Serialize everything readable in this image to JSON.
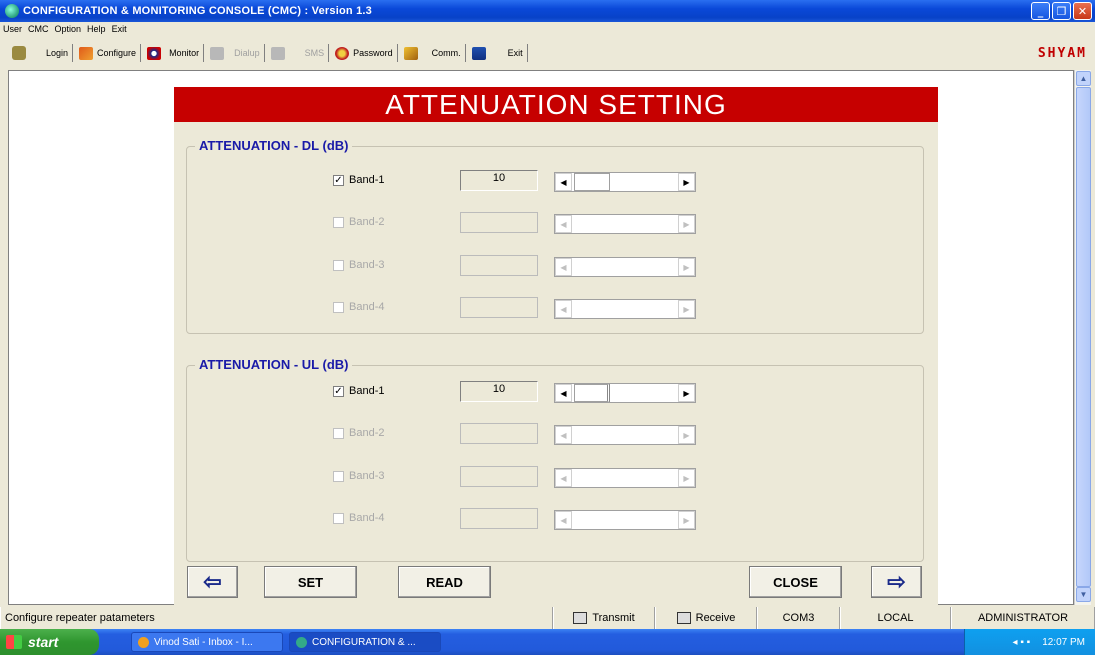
{
  "window": {
    "title": "CONFIGURATION & MONITORING CONSOLE (CMC)  :  Version 1.3",
    "buttons": [
      "minimize",
      "maximize",
      "close"
    ]
  },
  "menu": [
    "User",
    "CMC",
    "Option",
    "Help",
    "Exit"
  ],
  "toolbar": {
    "items": [
      {
        "label": "Login",
        "icon": "login-icon",
        "enabled": true
      },
      {
        "label": "Configure",
        "icon": "configure-icon",
        "enabled": true
      },
      {
        "label": "Monitor",
        "icon": "monitor-icon",
        "enabled": true
      },
      {
        "label": "Dialup",
        "icon": "dialup-icon",
        "enabled": false
      },
      {
        "label": "SMS",
        "icon": "sms-icon",
        "enabled": false
      },
      {
        "label": "Password",
        "icon": "password-icon",
        "enabled": true
      },
      {
        "label": "Comm.",
        "icon": "comm-icon",
        "enabled": true
      },
      {
        "label": "Exit",
        "icon": "exit-icon",
        "enabled": true
      }
    ],
    "brand": "SHYAM"
  },
  "dialog": {
    "title": "ATTENUATION SETTING",
    "dl": {
      "label": "ATTENUATION - DL (dB)",
      "bands": [
        {
          "label": "Band-1",
          "checked": true,
          "enabled": true,
          "value": "10",
          "slider_fraction": 0.2
        },
        {
          "label": "Band-2",
          "checked": false,
          "enabled": false,
          "value": ""
        },
        {
          "label": "Band-3",
          "checked": false,
          "enabled": false,
          "value": ""
        },
        {
          "label": "Band-4",
          "checked": false,
          "enabled": false,
          "value": ""
        }
      ]
    },
    "ul": {
      "label": "ATTENUATION - UL (dB)",
      "bands": [
        {
          "label": "Band-1",
          "checked": true,
          "enabled": true,
          "value": "10",
          "slider_fraction": 0.2
        },
        {
          "label": "Band-2",
          "checked": false,
          "enabled": false,
          "value": ""
        },
        {
          "label": "Band-3",
          "checked": false,
          "enabled": false,
          "value": ""
        },
        {
          "label": "Band-4",
          "checked": false,
          "enabled": false,
          "value": ""
        }
      ]
    },
    "buttons": {
      "back": "⇦",
      "set": "SET",
      "read": "READ",
      "close": "CLOSE",
      "next": "⇨"
    }
  },
  "statusbar": {
    "message": "Configure repeater patameters",
    "transmit": "Transmit",
    "receive": "Receive",
    "port": "COM3",
    "mode": "LOCAL",
    "user": "ADMINISTRATOR"
  },
  "taskbar": {
    "start": "start",
    "tasks": [
      "Vinod Sati - Inbox - I...",
      "CONFIGURATION & ..."
    ],
    "clock": "12:07 PM"
  }
}
